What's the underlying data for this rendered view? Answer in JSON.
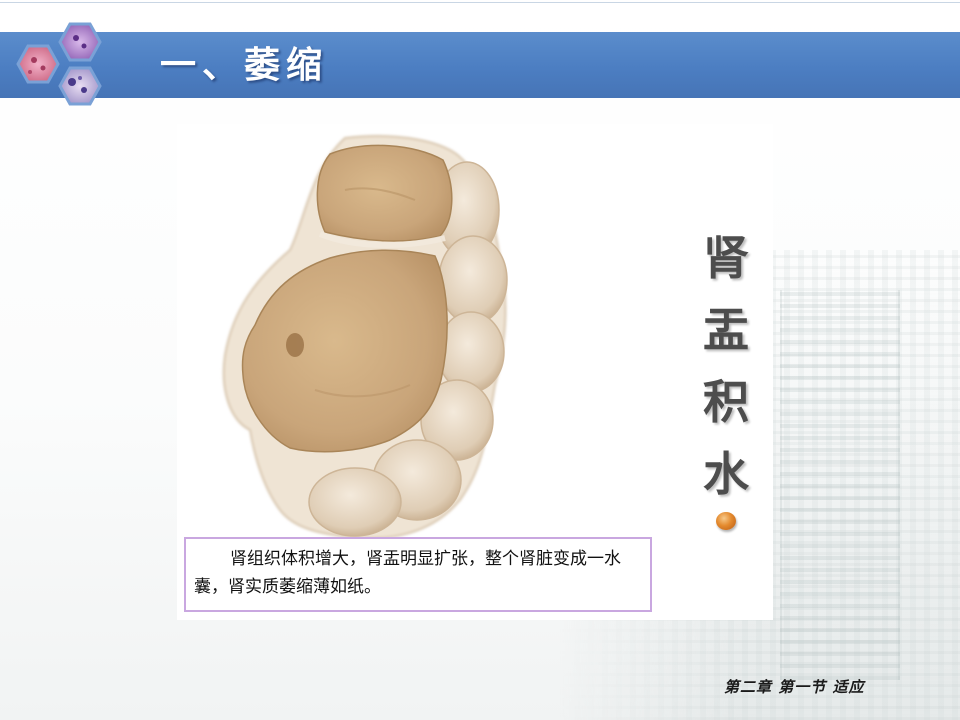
{
  "header": {
    "title": "一、萎缩"
  },
  "figure": {
    "vertical_title_chars": [
      "肾",
      "盂",
      "积",
      "水"
    ],
    "caption": "肾组织体积增大，肾盂明显扩张，整个肾脏变成一水囊，肾实质萎缩薄如纸。"
  },
  "footer": {
    "label": "第二章 第一节 适应"
  },
  "colors": {
    "header_bar": "#4c7ec2",
    "caption_border": "#c9a7e0",
    "bullet": "#e48a2e"
  },
  "icons": {
    "logo": "hexagon-microscopy-logo",
    "bullet": "orange-dot"
  }
}
